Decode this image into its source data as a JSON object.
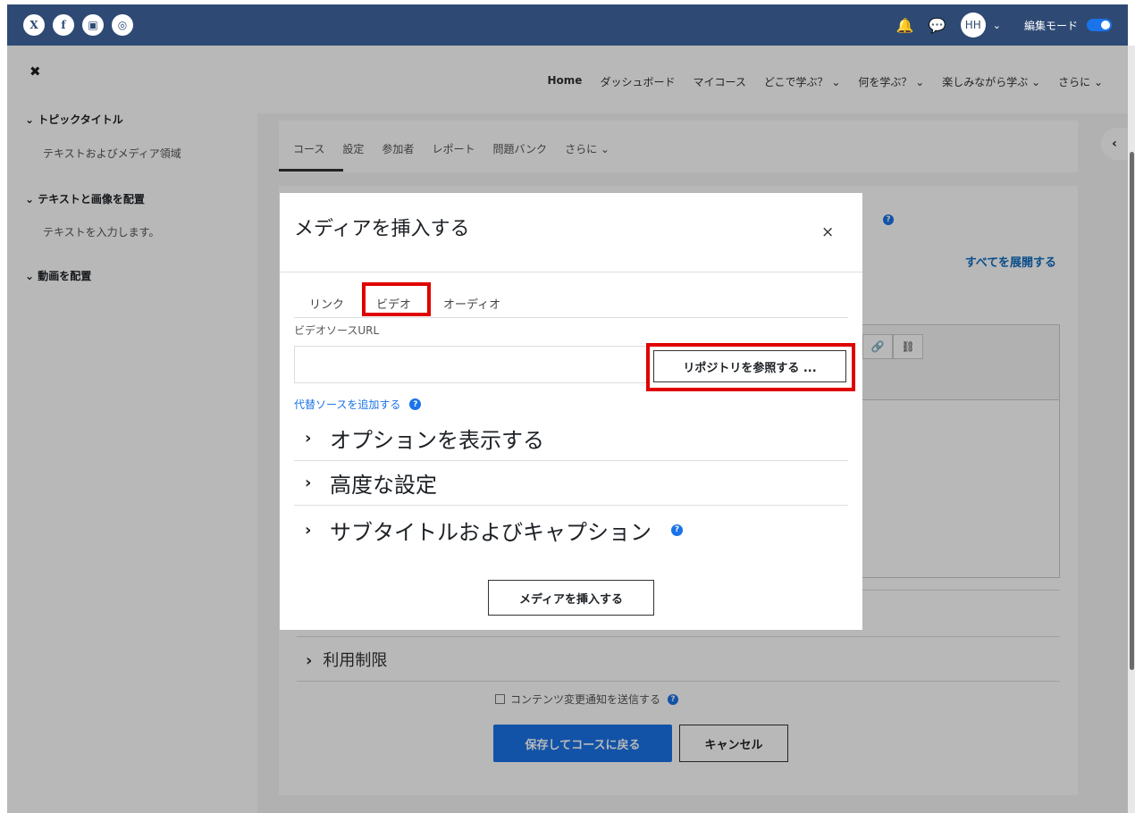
{
  "topbar": {
    "social": [
      {
        "icon": "x-icon",
        "glyph": "X"
      },
      {
        "icon": "facebook-icon",
        "glyph": "f"
      },
      {
        "icon": "youtube-icon",
        "glyph": "▣"
      },
      {
        "icon": "instagram-icon",
        "glyph": "◎"
      }
    ],
    "bell_glyph": "🔔",
    "chat_glyph": "💬",
    "avatar_initials": "HH",
    "chevron": "⌄",
    "edit_mode_label": "編集モード",
    "edit_mode_on": true
  },
  "drawer": {
    "close_glyph": "✖",
    "sections": [
      {
        "title": "トピックタイトル",
        "item": "テキストおよびメディア領域"
      },
      {
        "title": "テキストと画像を配置",
        "item": "テキストを入力します。"
      },
      {
        "title": "動画を配置",
        "item": ""
      }
    ]
  },
  "main_nav": {
    "items": [
      "Home",
      "ダッシュボード",
      "マイコース",
      "どこで学ぶ？ ⌄",
      "何を学ぶ？ ⌄",
      "楽しみながら学ぶ ⌄",
      "さらに ⌄"
    ]
  },
  "secondary_nav": {
    "tabs": [
      "コース",
      "設定",
      "参加者",
      "レポート",
      "問題バンク",
      "さらに ⌄"
    ]
  },
  "drawer_toggle_glyph": "‹",
  "content": {
    "help_glyph": "?",
    "expand_all": "すべてを展開する",
    "link_glyph": "🔗",
    "unlink_glyph": "⛓",
    "restrict": {
      "arrow": "›",
      "label": "利用制限"
    },
    "notify_label": "コンテンツ変更通知を送信する",
    "save_button": "保存してコースに戻る",
    "cancel_button": "キャンセル"
  },
  "modal": {
    "title": "メディアを挿入する",
    "close_glyph": "×",
    "tabs": [
      "リンク",
      "ビデオ",
      "オーディオ"
    ],
    "active_tab": "ビデオ",
    "source_label": "ビデオソースURL",
    "source_value": "",
    "browse_button": "リポジトリを参照する ...",
    "add_source": "代替ソースを追加する",
    "accordions": [
      {
        "arrow": "›",
        "label": "オプションを表示する"
      },
      {
        "arrow": "›",
        "label": "高度な設定"
      },
      {
        "arrow": "›",
        "label": "サブタイトルおよびキャプション"
      }
    ],
    "insert_button": "メディアを挿入する"
  },
  "colors": {
    "topbar": "#2e4a74",
    "primary": "#1a73e8",
    "highlight": "#e00000"
  }
}
